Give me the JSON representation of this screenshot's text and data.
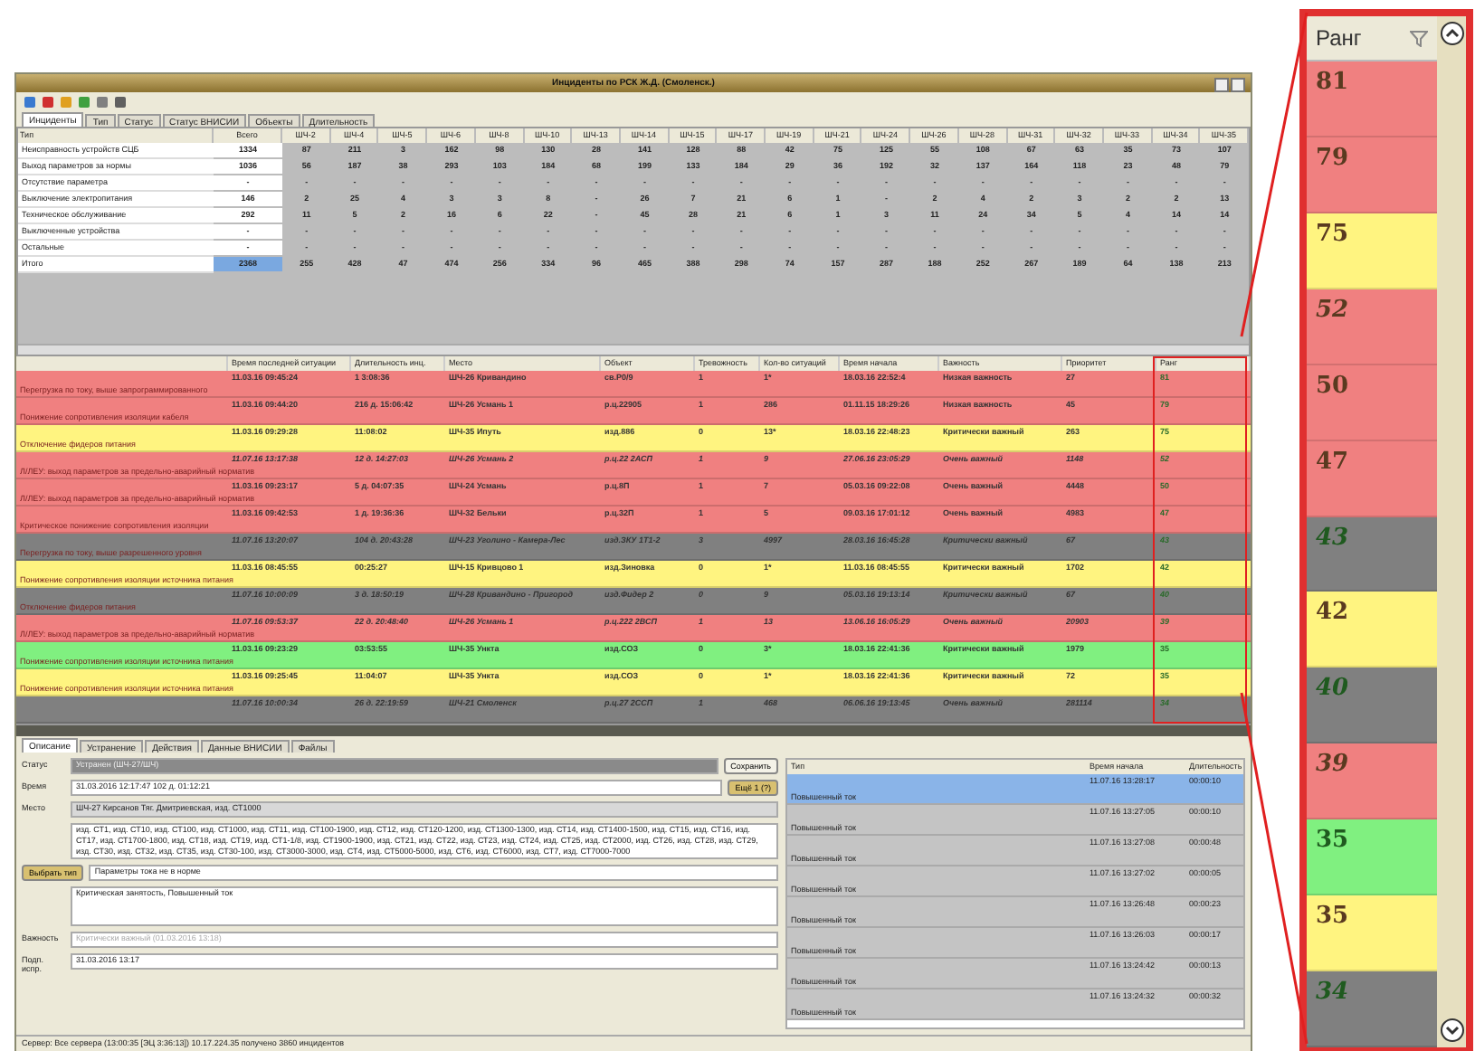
{
  "window": {
    "title": "Инциденты по РСК Ж.Д. (Смоленск.)"
  },
  "tabs": [
    {
      "label": "Инциденты",
      "selected": true
    },
    {
      "label": "Тип",
      "selected": false
    },
    {
      "label": "Статус",
      "selected": false
    },
    {
      "label": "Статус ВНИСИИ",
      "selected": false
    },
    {
      "label": "Объекты",
      "selected": false
    },
    {
      "label": "Длительность",
      "selected": false
    }
  ],
  "summary": {
    "label_header": "Тип",
    "columns": [
      "Всего",
      "ШЧ-2",
      "ШЧ-4",
      "ШЧ-5",
      "ШЧ-6",
      "ШЧ-8",
      "ШЧ-10",
      "ШЧ-13",
      "ШЧ-14",
      "ШЧ-15",
      "ШЧ-17",
      "ШЧ-19",
      "ШЧ-21",
      "ШЧ-24",
      "ШЧ-26",
      "ШЧ-28",
      "ШЧ-31",
      "ШЧ-32",
      "ШЧ-33",
      "ШЧ-34",
      "ШЧ-35"
    ],
    "rows": [
      {
        "label": "Неисправность устройств СЦБ",
        "highlighted": false,
        "cells": [
          "1334",
          "87",
          "211",
          "3",
          "162",
          "98",
          "130",
          "28",
          "141",
          "128",
          "88",
          "42",
          "75",
          "125",
          "55",
          "108",
          "67",
          "63",
          "35",
          "73",
          "107"
        ]
      },
      {
        "label": "Выход параметров за нормы",
        "highlighted": false,
        "cells": [
          "1036",
          "56",
          "187",
          "38",
          "293",
          "103",
          "184",
          "68",
          "199",
          "133",
          "184",
          "29",
          "36",
          "192",
          "32",
          "137",
          "164",
          "118",
          "23",
          "48",
          "79"
        ]
      },
      {
        "label": "Отсутствие параметра",
        "highlighted": false,
        "cells": [
          "-",
          "-",
          "-",
          "-",
          "-",
          "-",
          "-",
          "-",
          "-",
          "-",
          "-",
          "-",
          "-",
          "-",
          "-",
          "-",
          "-",
          "-",
          "-",
          "-",
          "-"
        ]
      },
      {
        "label": "Выключение электропитания",
        "highlighted": false,
        "cells": [
          "146",
          "2",
          "25",
          "4",
          "3",
          "3",
          "8",
          "-",
          "26",
          "7",
          "21",
          "6",
          "1",
          "-",
          "2",
          "4",
          "2",
          "3",
          "2",
          "2",
          "13"
        ]
      },
      {
        "label": "Техническое обслуживание",
        "highlighted": false,
        "cells": [
          "292",
          "11",
          "5",
          "2",
          "16",
          "6",
          "22",
          "-",
          "45",
          "28",
          "21",
          "6",
          "1",
          "3",
          "11",
          "24",
          "34",
          "5",
          "4",
          "14",
          "14"
        ]
      },
      {
        "label": "Выключенные устройства",
        "highlighted": false,
        "cells": [
          "-",
          "-",
          "-",
          "-",
          "-",
          "-",
          "-",
          "-",
          "-",
          "-",
          "-",
          "-",
          "-",
          "-",
          "-",
          "-",
          "-",
          "-",
          "-",
          "-",
          "-"
        ]
      },
      {
        "label": "Остальные",
        "highlighted": false,
        "cells": [
          "-",
          "-",
          "-",
          "-",
          "-",
          "-",
          "-",
          "-",
          "-",
          "-",
          "-",
          "-",
          "-",
          "-",
          "-",
          "-",
          "-",
          "-",
          "-",
          "-",
          "-"
        ]
      },
      {
        "label": "Итого",
        "highlighted": true,
        "cells": [
          "2368",
          "255",
          "428",
          "47",
          "474",
          "256",
          "334",
          "96",
          "465",
          "388",
          "298",
          "74",
          "157",
          "287",
          "188",
          "252",
          "267",
          "189",
          "64",
          "138",
          "213"
        ]
      }
    ]
  },
  "incidents": {
    "columns": [
      "Время последней ситуации",
      "Длительность инц.",
      "Место",
      "Объект",
      "Тревожность",
      "Кол-во ситуаций",
      "Время начала",
      "Важность",
      "Приоритет",
      "Ранг"
    ],
    "rows": [
      {
        "color": "#f08080",
        "italic": false,
        "cells": [
          "11.03.16 09:45:24",
          "1 3:08:36",
          "ШЧ-26 Кривандино",
          "св.Р0/9",
          "1",
          "1*",
          "18.03.16 22:52:4",
          "Низкая важность",
          "27",
          "81"
        ],
        "description": "Перегрузка по току, выше запрограммированного"
      },
      {
        "color": "#f08080",
        "italic": false,
        "cells": [
          "11.03.16 09:44:20",
          "216 д. 15:06:42",
          "ШЧ-26 Усмань 1",
          "р.ц.22905",
          "1",
          "286",
          "01.11.15 18:29:26",
          "Низкая важность",
          "45",
          "79"
        ],
        "description": "Понижение сопротивления изоляции кабеля"
      },
      {
        "color": "#fff480",
        "italic": false,
        "cells": [
          "11.03.16 09:29:28",
          "11:08:02",
          "ШЧ-35 Ипуть",
          "изд.886",
          "0",
          "13*",
          "18.03.16 22:48:23",
          "Критически важный",
          "263",
          "75"
        ],
        "description": "Отключение фидеров питания"
      },
      {
        "color": "#f08080",
        "italic": true,
        "cells": [
          "11.07.16 13:17:38",
          "12 д. 14:27:03",
          "ШЧ-26 Усмань 2",
          "р.ц.22 2АСП",
          "1",
          "9",
          "27.06.16 23:05:29",
          "Очень важный",
          "1148",
          "52"
        ],
        "description": "Л/ЛЕУ: выход параметров за предельно-аварийный норматив"
      },
      {
        "color": "#f08080",
        "italic": false,
        "cells": [
          "11.03.16 09:23:17",
          "5 д. 04:07:35",
          "ШЧ-24 Усмань",
          "р.ц.8П",
          "1",
          "7",
          "05.03.16 09:22:08",
          "Очень важный",
          "4448",
          "50"
        ],
        "description": "Л/ЛЕУ: выход параметров за предельно-аварийный норматив"
      },
      {
        "color": "#f08080",
        "italic": false,
        "cells": [
          "11.03.16 09:42:53",
          "1 д. 19:36:36",
          "ШЧ-32 Бельки",
          "р.ц.32П",
          "1",
          "5",
          "09.03.16 17:01:12",
          "Очень важный",
          "4983",
          "47"
        ],
        "description": "Критическое понижение сопротивления изоляции"
      },
      {
        "color": "#808080",
        "italic": true,
        "cells": [
          "11.07.16 13:20:07",
          "104 д. 20:43:28",
          "ШЧ-23 Уголино - Камера-Лес",
          "изд.ЗКУ 1Т1-2",
          "3",
          "4997",
          "28.03.16 16:45:28",
          "Критически важный",
          "67",
          "43"
        ],
        "description": "Перегрузка по току, выше разрешенного уровня"
      },
      {
        "color": "#fff480",
        "italic": false,
        "cells": [
          "11.03.16 08:45:55",
          "00:25:27",
          "ШЧ-15 Кривцово 1",
          "изд.Зиновка",
          "0",
          "1*",
          "11.03.16 08:45:55",
          "Критически важный",
          "1702",
          "42"
        ],
        "description": "Понижение сопротивления изоляции источника питания"
      },
      {
        "color": "#808080",
        "italic": true,
        "cells": [
          "11.07.16 10:00:09",
          "3 д. 18:50:19",
          "ШЧ-28 Кривандино - Пригород",
          "изд.Фидер 2",
          "0",
          "9",
          "05.03.16 19:13:14",
          "Критически важный",
          "67",
          "40"
        ],
        "description": "Отключение фидеров питания"
      },
      {
        "color": "#f08080",
        "italic": true,
        "cells": [
          "11.07.16 09:53:37",
          "22 д. 20:48:40",
          "ШЧ-26 Усмань 1",
          "р.ц.222 2ВСП",
          "1",
          "13",
          "13.06.16 16:05:29",
          "Очень важный",
          "20903",
          "39"
        ],
        "description": "Л/ЛЕУ: выход параметров за предельно-аварийный норматив"
      },
      {
        "color": "#80f080",
        "italic": false,
        "cells": [
          "11.03.16 09:23:29",
          "03:53:55",
          "ШЧ-35 Ункта",
          "изд.СОЗ",
          "0",
          "3*",
          "18.03.16 22:41:36",
          "Критически важный",
          "1979",
          "35"
        ],
        "description": "Понижение сопротивления изоляции источника питания"
      },
      {
        "color": "#fff480",
        "italic": false,
        "cells": [
          "11.03.16 09:25:45",
          "11:04:07",
          "ШЧ-35 Ункта",
          "изд.СОЗ",
          "0",
          "1*",
          "18.03.16 22:41:36",
          "Критически важный",
          "72",
          "35"
        ],
        "description": "Понижение сопротивления изоляции источника питания"
      },
      {
        "color": "#808080",
        "italic": true,
        "cells": [
          "11.07.16 10:00:34",
          "26 д. 22:19:59",
          "ШЧ-21 Смоленск",
          "р.ц.27 2ССП",
          "1",
          "468",
          "06.06.16 19:13:45",
          "Очень важный",
          "281114",
          "34"
        ]
      }
    ]
  },
  "detail": {
    "tabs": [
      {
        "label": "Описание",
        "selected": true
      },
      {
        "label": "Устранение",
        "selected": false
      },
      {
        "label": "Действия",
        "selected": false
      },
      {
        "label": "Данные ВНИСИИ",
        "selected": false
      },
      {
        "label": "Файлы",
        "selected": false
      }
    ],
    "status_label": "Статус",
    "status": "Устранен (ШЧ-27/ШЧ)",
    "save": "Сохранить",
    "time_label": "Время",
    "time": "31.03.2016 12:17:47   102 д. 01:12:21",
    "more": "Ещё 1 (?)",
    "place_label": "Место",
    "place": "ШЧ-27 Кирсанов Тяг. Дмитриевская, изд. СТ1000",
    "objects": "изд. СТ1, изд. СТ10, изд. СТ100, изд. СТ1000, изд. СТ11, изд. СТ100-1900, изд. СТ12, изд. СТ120-1200, изд. СТ1300-1300, изд. СТ14, изд. СТ1400-1500, изд. СТ15, изд. СТ16, изд. СТ17, изд. СТ1700-1800, изд. СТ18, изд. СТ19, изд. СТ1-1/8, изд. СТ1900-1900, изд. СТ21, изд. СТ22, изд. СТ23, изд. СТ24, изд. СТ25, изд. СТ2000, изд. СТ26, изд. СТ28, изд. СТ29, изд. СТ30, изд. СТ32, изд. СТ35, изд. СТ30-100, изд. СТ3000-3000, изд. СТ4, изд. СТ5000-5000, изд. СТ6, изд. СТ6000, изд. СТ7, изд. СТ7000-7000",
    "type_button": "Выбрать тип",
    "type": "Параметры тока не в норме",
    "type_details": "Критическая занятость, Повышенный ток",
    "importance_label": "Важность",
    "importance": "Критически важный (01.03.2016 13:18)",
    "signed_label": "Подп. испр.",
    "signed": "31.03.2016 13:17"
  },
  "events": {
    "columns": [
      "Тип",
      "Время начала",
      "Длительность"
    ],
    "rows": [
      {
        "type": "Повышенный ток",
        "start": "11.07.16 13:28:17",
        "duration": "00:00:10",
        "selected": true
      },
      {
        "type": "Повышенный ток",
        "start": "11.07.16 13:27:05",
        "duration": "00:00:10",
        "selected": false
      },
      {
        "type": "Повышенный ток",
        "start": "11.07.16 13:27:08",
        "duration": "00:00:48",
        "selected": false
      },
      {
        "type": "Повышенный ток",
        "start": "11.07.16 13:27:02",
        "duration": "00:00:05",
        "selected": false
      },
      {
        "type": "Повышенный ток",
        "start": "11.07.16 13:26:48",
        "duration": "00:00:23",
        "selected": false
      },
      {
        "type": "Повышенный ток",
        "start": "11.07.16 13:26:03",
        "duration": "00:00:17",
        "selected": false
      },
      {
        "type": "Повышенный ток",
        "start": "11.07.16 13:24:42",
        "duration": "00:00:13",
        "selected": false
      },
      {
        "type": "Повышенный ток",
        "start": "11.07.16 13:24:32",
        "duration": "00:00:32",
        "selected": false
      }
    ]
  },
  "status_bar": "Сервер: Все сервера (13:00:35 [ЭЦ 3:36:13])  10.17.224.35 получено 3860 инцидентов",
  "callout": {
    "header": "Ранг",
    "rows": [
      {
        "value": "81",
        "color": "#f08080",
        "italic": false
      },
      {
        "value": "79",
        "color": "#f08080",
        "italic": false
      },
      {
        "value": "75",
        "color": "#fff480",
        "italic": false
      },
      {
        "value": "52",
        "color": "#f08080",
        "italic": true
      },
      {
        "value": "50",
        "color": "#f08080",
        "italic": false
      },
      {
        "value": "47",
        "color": "#f08080",
        "italic": false
      },
      {
        "value": "43",
        "color": "#808080",
        "italic": true
      },
      {
        "value": "42",
        "color": "#fff480",
        "italic": false
      },
      {
        "value": "40",
        "color": "#808080",
        "italic": true
      },
      {
        "value": "39",
        "color": "#f08080",
        "italic": true
      },
      {
        "value": "35",
        "color": "#80f080",
        "italic": false
      },
      {
        "value": "35",
        "color": "#fff480",
        "italic": false
      },
      {
        "value": "34",
        "color": "#808080",
        "italic": true
      }
    ]
  }
}
